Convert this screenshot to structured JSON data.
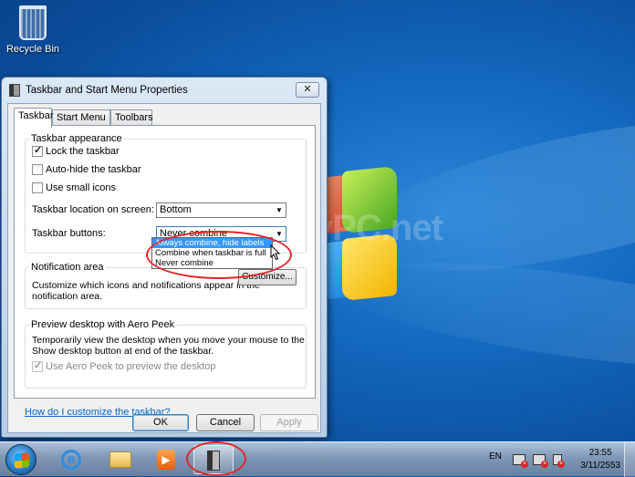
{
  "desktop": {
    "recycle_bin_label": "Recycle Bin",
    "watermark": "VarietyPC.net"
  },
  "dialog": {
    "title": "Taskbar and Start Menu Properties",
    "close_glyph": "✕",
    "tabs": [
      "Taskbar",
      "Start Menu",
      "Toolbars"
    ],
    "taskbar_appearance": {
      "title": "Taskbar appearance",
      "lock_taskbar": "Lock the taskbar",
      "auto_hide": "Auto-hide the taskbar",
      "small_icons": "Use small icons",
      "location_label": "Taskbar location on screen:",
      "location_value": "Bottom",
      "buttons_label": "Taskbar buttons:",
      "buttons_value": "Never combine",
      "buttons_options": [
        "Always combine, hide labels",
        "Combine when taskbar is full",
        "Never combine"
      ]
    },
    "notification_area": {
      "title": "Notification area",
      "desc_line1": "Customize which icons and notifications appear in the",
      "desc_line2": "notification area.",
      "customize_button": "Customize..."
    },
    "aero_peek": {
      "title": "Preview desktop with Aero Peek",
      "desc_line1": "Temporarily view the desktop when you move your mouse to the",
      "desc_line2": "Show desktop button at end of the taskbar.",
      "use_aero_peek": "Use Aero Peek to preview the desktop"
    },
    "help_link": "How do I customize the taskbar?",
    "ok": "OK",
    "cancel": "Cancel",
    "apply": "Apply"
  },
  "taskbar": {
    "language": "EN",
    "time": "23:55",
    "date": "3/11/2553",
    "ie_glyph": "e",
    "media_glyph": "▶"
  },
  "colors": {
    "selection": "#3399ff",
    "annotation_red": "#e0262a",
    "link": "#0066cc"
  }
}
